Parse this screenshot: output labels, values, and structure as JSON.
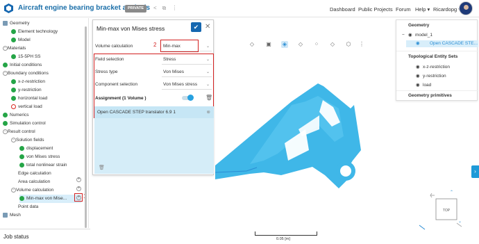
{
  "app": {
    "project_title": "Aircraft engine bearing bracket analysis",
    "privacy_badge": "PRIVATE",
    "nav": [
      "Dashboard",
      "Public Projects",
      "Forum",
      "Help ▾",
      "Ricardopg ▾"
    ]
  },
  "tree": {
    "rows": [
      {
        "label": "Geometry",
        "status": "geom"
      },
      {
        "label": "Element technology",
        "status": "ok"
      },
      {
        "label": "Model",
        "status": "ok"
      },
      {
        "label": "Materials",
        "status": "toggle"
      },
      {
        "label": "15-5PH SS",
        "status": "ok"
      },
      {
        "label": "Initial conditions",
        "status": "ok"
      },
      {
        "label": "Boundary conditions",
        "status": "toggle"
      },
      {
        "label": "x-z-restriction",
        "status": "ok"
      },
      {
        "label": "y-restriction",
        "status": "ok"
      },
      {
        "label": "horizontal load",
        "status": "ok"
      },
      {
        "label": "vertical load",
        "status": "err"
      },
      {
        "label": "Numerics",
        "status": "ok"
      },
      {
        "label": "Simulation control",
        "status": "ok"
      },
      {
        "label": "Result control",
        "status": "toggle"
      },
      {
        "label": "Solution fields",
        "status": "toggle"
      },
      {
        "label": "displacement",
        "status": "ok"
      },
      {
        "label": "von Mises stress",
        "status": "ok"
      },
      {
        "label": "total nonlinear strain",
        "status": "ok"
      },
      {
        "label": "Edge calculation",
        "status": "none"
      },
      {
        "label": "Area calculation",
        "status": "none"
      },
      {
        "label": "Volume calculation",
        "status": "toggle"
      },
      {
        "label": "Min-max von Mise...",
        "status": "ok"
      },
      {
        "label": "Point data",
        "status": "none"
      },
      {
        "label": "Mesh",
        "status": "mesh"
      }
    ],
    "annotation_1": "1"
  },
  "job_status": "Job status",
  "panel": {
    "title": "Min-max von Mises stress",
    "volume_calculation_label": "Volume calculation",
    "volume_calculation_value": "Min-max",
    "field_selection_label": "Field selection",
    "field_selection_value": "Stress",
    "stress_type_label": "Stress type",
    "stress_type_value": "Von Mises",
    "component_label": "Component selection",
    "component_value": "Von Mises stress",
    "assignment_label": "Assignment (1 Volume )",
    "assignment_item": "Open CASCADE STEP translator 6.9 1",
    "annotation_2": "2",
    "annotation_3": "3"
  },
  "viewer": {
    "scale_label": "0.05 [m]",
    "cube_label": "TOP"
  },
  "right_panel": {
    "geometry_header": "Geometry",
    "model": "model_1",
    "geometry_item": "Open CASCADE STE...",
    "topo_header": "Topological Entity Sets",
    "topo_items": [
      "x-z-restriction",
      "y-restriction",
      "load"
    ],
    "primitives_header": "Geometry primitives"
  },
  "colors": {
    "accent": "#1567b0",
    "ok": "#25a547",
    "error": "#d9241c",
    "annotation": "#d21f1f",
    "model": "#3fb7e8"
  }
}
